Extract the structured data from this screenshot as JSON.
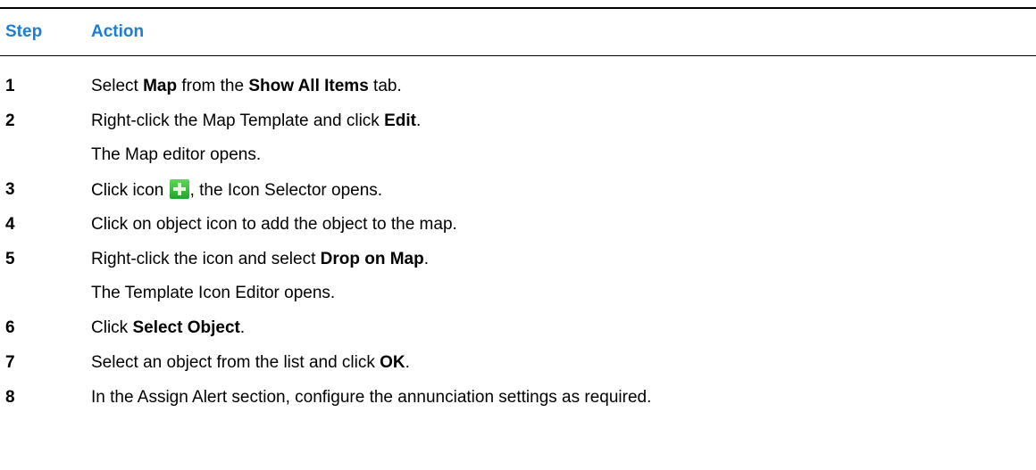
{
  "table": {
    "header": {
      "step_label": "Step",
      "action_label": "Action"
    },
    "rows": [
      {
        "num": "1",
        "parts": [
          "Select ",
          "Map",
          " from the ",
          "Show All Items",
          " tab."
        ]
      },
      {
        "num": "2",
        "parts": [
          "Right-click the Map Template and click ",
          "Edit",
          "."
        ]
      },
      {
        "note": "The Map editor opens."
      },
      {
        "num": "3",
        "parts": [
          "Click icon ",
          ", the Icon Selector opens."
        ],
        "icon": "green-plus-icon"
      },
      {
        "num": "4",
        "parts": [
          "Click on object icon to add the object to the map."
        ]
      },
      {
        "num": "5",
        "parts": [
          "Right-click the icon and select ",
          "Drop on Map",
          "."
        ]
      },
      {
        "note": "The Template Icon Editor opens."
      },
      {
        "num": "6",
        "parts": [
          "Click ",
          "Select Object",
          "."
        ]
      },
      {
        "num": "7",
        "parts": [
          "Select an object from the list and click ",
          "OK",
          "."
        ]
      },
      {
        "num": "8",
        "parts": [
          "In the Assign Alert section, configure the annunciation settings as required."
        ]
      }
    ]
  },
  "colors": {
    "header_text": "#1a7fd4",
    "icon_green": "#2fbf3a"
  }
}
